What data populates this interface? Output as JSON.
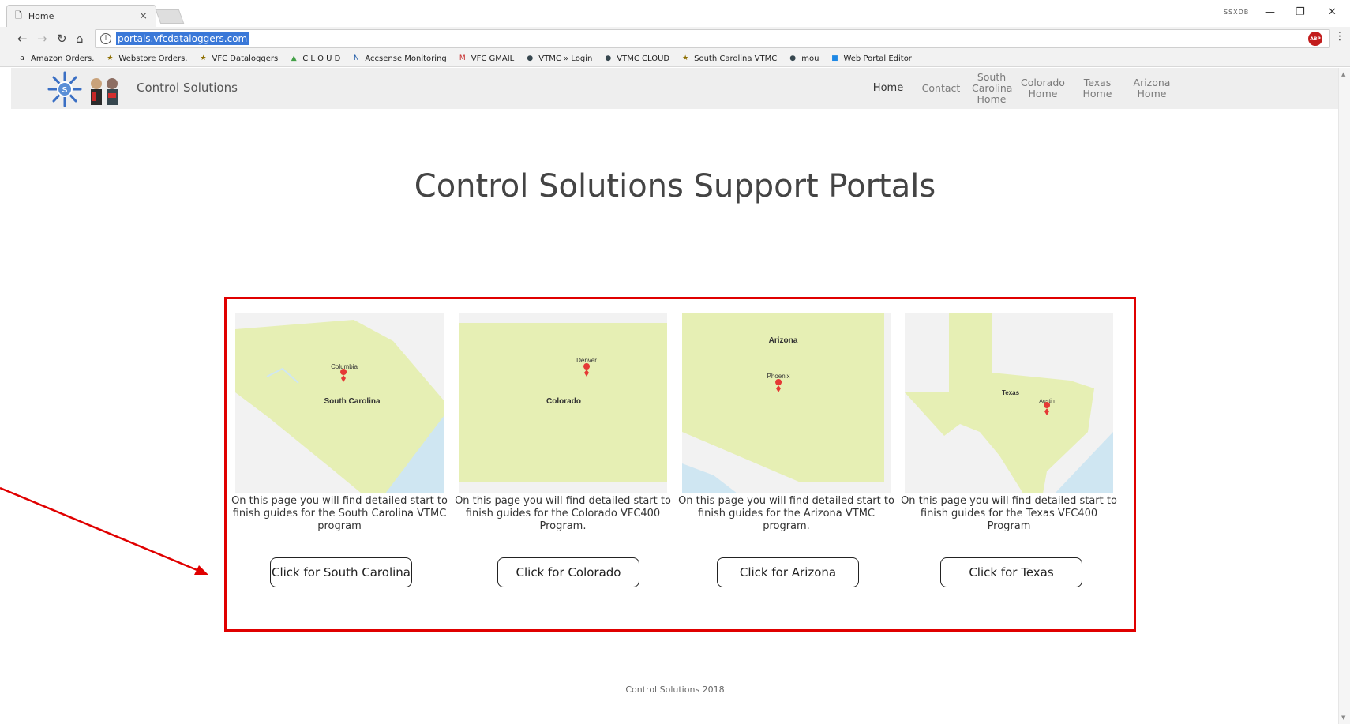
{
  "browser": {
    "tab_title": "Home",
    "tab_close": "×",
    "profile_label": "SSXDB",
    "url": "portals.vfcdataloggers.com",
    "bookmarks": [
      {
        "icon": "a",
        "label": "Amazon Orders."
      },
      {
        "icon": "★",
        "label": "Webstore Orders."
      },
      {
        "icon": "★",
        "label": "VFC Dataloggers"
      },
      {
        "icon": "▲",
        "label": "C L O U D"
      },
      {
        "icon": "N",
        "label": "Accsense Monitoring"
      },
      {
        "icon": "M",
        "label": "VFC GMAIL"
      },
      {
        "icon": "●",
        "label": "VTMC » Login"
      },
      {
        "icon": "●",
        "label": "VTMC CLOUD"
      },
      {
        "icon": "★",
        "label": "South Carolina VTMC"
      },
      {
        "icon": "●",
        "label": "mou"
      },
      {
        "icon": "■",
        "label": "Web Portal Editor"
      }
    ]
  },
  "site": {
    "brand": "Control Solutions",
    "nav": [
      {
        "label": "Home"
      },
      {
        "label": "Contact"
      },
      {
        "label": "South Carolina Home"
      },
      {
        "label": "Colorado Home"
      },
      {
        "label": "Texas Home"
      },
      {
        "label": "Arizona Home"
      }
    ]
  },
  "page": {
    "title": "Control Solutions Support Portals",
    "cards": [
      {
        "map_labels": {
          "city": "Columbia",
          "state": "South Carolina"
        },
        "description": "On this page you will find detailed start to finish guides for the South Carolina VTMC program",
        "button": "Click for South Carolina"
      },
      {
        "map_labels": {
          "city": "Denver",
          "state": "Colorado"
        },
        "description": "On this page you will find detailed start to finish guides for the Colorado VFC400 Program.",
        "button": "Click for Colorado"
      },
      {
        "map_labels": {
          "city": "Phoenix",
          "state": "Arizona"
        },
        "description": "On this page you will find detailed start to finish guides for the Arizona VTMC program.",
        "button": "Click for Arizona"
      },
      {
        "map_labels": {
          "city": "Austin",
          "state": "Texas"
        },
        "description": "On this page you will find detailed start to finish guides for the Texas VFC400 Program",
        "button": "Click for Texas"
      }
    ],
    "footer": "Control Solutions 2018"
  },
  "colors": {
    "annotation": "#e00000",
    "map_land": "#e6efb4",
    "map_water": "#cfe6f2",
    "pin": "#e53935"
  }
}
